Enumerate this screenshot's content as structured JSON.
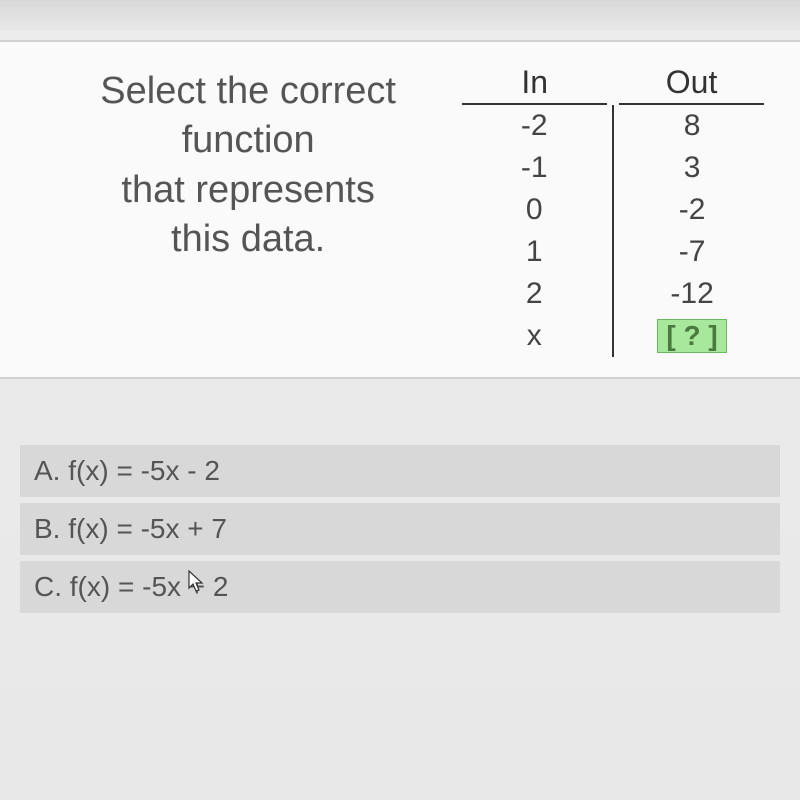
{
  "prompt": {
    "line1": "Select the correct",
    "line2": "function",
    "line3": "that represents",
    "line4": "this data."
  },
  "table": {
    "headers": {
      "in": "In",
      "out": "Out"
    },
    "rows": [
      {
        "in": "-2",
        "out": "8"
      },
      {
        "in": "-1",
        "out": "3"
      },
      {
        "in": "0",
        "out": "-2"
      },
      {
        "in": "1",
        "out": "-7"
      },
      {
        "in": "2",
        "out": "-12"
      },
      {
        "in": "x",
        "out": "[ ? ]"
      }
    ]
  },
  "options": {
    "a": "A. f(x) = -5x - 2",
    "b": "B. f(x) = -5x + 7",
    "c": "C. f(x) = -5x + 2"
  },
  "chart_data": {
    "type": "table",
    "columns": [
      "In",
      "Out"
    ],
    "rows": [
      [
        -2,
        8
      ],
      [
        -1,
        3
      ],
      [
        0,
        -2
      ],
      [
        1,
        -7
      ],
      [
        2,
        -12
      ]
    ],
    "unknown_row": [
      "x",
      "?"
    ],
    "title": "Select the correct function that represents this data.",
    "choices": [
      "f(x) = -5x - 2",
      "f(x) = -5x + 7",
      "f(x) = -5x + 2"
    ]
  }
}
